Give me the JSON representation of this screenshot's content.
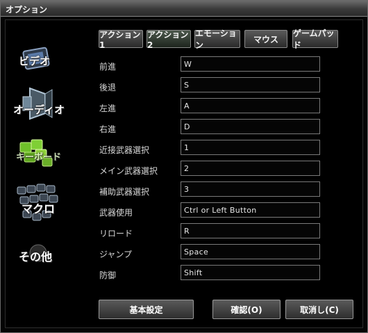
{
  "window": {
    "title": "オプション"
  },
  "tabs": [
    {
      "label": "アクション1"
    },
    {
      "label": "アクション2"
    },
    {
      "label": "エモーション"
    },
    {
      "label": "マウス"
    },
    {
      "label": "ゲームパッド"
    }
  ],
  "sidebar": [
    {
      "label": "ビデオ",
      "icon": "video-icon"
    },
    {
      "label": "オーディオ",
      "icon": "audio-icon"
    },
    {
      "label": "キーボード",
      "icon": "keyboard-icon"
    },
    {
      "label": "マクロ",
      "icon": "macro-icon"
    },
    {
      "label": "その他",
      "icon": "other-icon"
    }
  ],
  "bindings": [
    {
      "label": "前進",
      "value": "W"
    },
    {
      "label": "後退",
      "value": "S"
    },
    {
      "label": "左進",
      "value": "A"
    },
    {
      "label": "右進",
      "value": "D"
    },
    {
      "label": "近接武器選択",
      "value": "1"
    },
    {
      "label": "メイン武器選択",
      "value": "2"
    },
    {
      "label": "補助武器選択",
      "value": "3"
    },
    {
      "label": "武器使用",
      "value": "Ctrl or Left Button"
    },
    {
      "label": "リロード",
      "value": "R"
    },
    {
      "label": "ジャンプ",
      "value": "Space"
    },
    {
      "label": "防御",
      "value": "Shift"
    }
  ],
  "buttons": {
    "defaults": "基本設定",
    "confirm": "確認(O)",
    "cancel": "取消し(C)"
  },
  "colors": {
    "active_tab": "#3b463b",
    "keyboard_accent": "#8ed03a"
  }
}
